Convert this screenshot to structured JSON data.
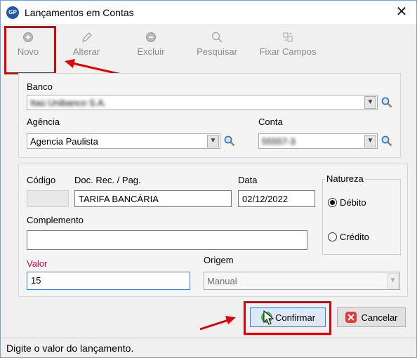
{
  "window": {
    "title": "Lançamentos em Contas",
    "app_icon": "GP"
  },
  "toolbar": {
    "novo": "Novo",
    "alterar": "Alterar",
    "excluir": "Excluir",
    "pesquisar": "Pesquisar",
    "fixar": "Fixar Campos"
  },
  "account": {
    "banco_label": "Banco",
    "banco_value": "Itaú Unibanco S.A.",
    "agencia_label": "Agência",
    "agencia_value": "Agencia Paulista",
    "conta_label": "Conta",
    "conta_value": "55557-3"
  },
  "entry": {
    "codigo_label": "Código",
    "codigo_value": "",
    "doc_label": "Doc. Rec. / Pag.",
    "doc_value": "TARIFA BANCÁRIA",
    "data_label": "Data",
    "data_value": "02/12/2022",
    "natureza_label": "Natureza",
    "debito": "Débito",
    "credito": "Crédito",
    "complemento_label": "Complemento",
    "complemento_value": "",
    "valor_label": "Valor",
    "valor_value": "15",
    "origem_label": "Origem",
    "origem_value": "Manual"
  },
  "buttons": {
    "confirmar": "Confirmar",
    "cancelar": "Cancelar"
  },
  "status": "Digite o valor do lançamento.",
  "colors": {
    "highlight": "#e00000",
    "valor_label": "#e0004b",
    "focus_border": "#3c7fd4"
  }
}
